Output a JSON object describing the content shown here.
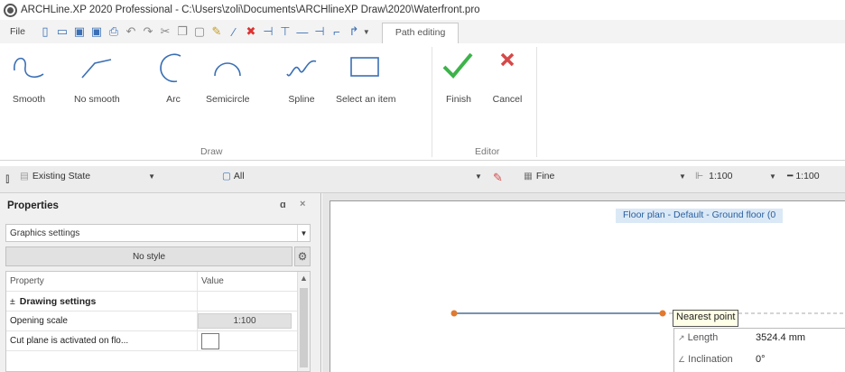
{
  "window": {
    "title": "ARCHLine.XP 2020  Professional - C:\\Users\\zoli\\Documents\\ARCHlineXP Draw\\2020\\Waterfront.pro"
  },
  "quick_access": {
    "file_label": "File",
    "context_tab_label": "Path editing"
  },
  "ribbon": {
    "draw_group": {
      "label": "Draw",
      "buttons": [
        {
          "label": "Smooth",
          "icon": "smooth-curve-icon"
        },
        {
          "label": "No smooth",
          "icon": "polyline-icon"
        },
        {
          "label": "Arc",
          "icon": "arc-icon"
        },
        {
          "label": "Semicircle",
          "icon": "semicircle-icon"
        },
        {
          "label": "Spline",
          "icon": "spline-icon"
        },
        {
          "label": "Select an item",
          "icon": "select-rectangle-icon"
        }
      ]
    },
    "editor_group": {
      "label": "Editor",
      "buttons": [
        {
          "label": "Finish",
          "icon": "checkmark-icon"
        },
        {
          "label": "Cancel",
          "icon": "x-icon"
        }
      ]
    }
  },
  "toolbar": {
    "state": "Existing State",
    "layer": "All",
    "line_quality": "Fine",
    "scale": "1:100",
    "scale2": "1:100"
  },
  "properties": {
    "title": "Properties",
    "pin_glyph": "ɑ",
    "close_glyph": "×",
    "settings_select": "Graphics settings",
    "style_button": "No style",
    "columns": {
      "property": "Property",
      "value": "Value"
    },
    "section": "Drawing settings",
    "rows": [
      {
        "property": "Opening scale",
        "value": "1:100"
      },
      {
        "property": "Cut plane is activated on flo...",
        "value": ""
      }
    ]
  },
  "canvas": {
    "view_tag": "Floor plan - Default - Ground floor (0",
    "snap_tooltip": "Nearest point",
    "dimension": {
      "length_label": "Length",
      "length_value": "3524.4 mm",
      "inclination_label": "Inclination",
      "inclination_value": "0°"
    }
  },
  "colors": {
    "accent_blue": "#3a6fb5",
    "finish_green": "#3db34a",
    "cancel_red": "#d64848",
    "line_blue": "#4d6f97",
    "endpoint_orange": "#e07a30"
  }
}
